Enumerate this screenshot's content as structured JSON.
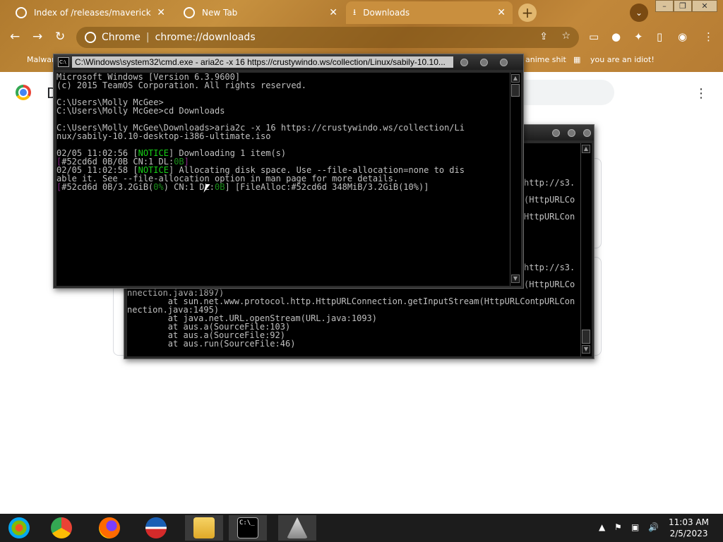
{
  "browser": {
    "tabs": [
      {
        "title": "Index of /releases/maverick"
      },
      {
        "title": "New Tab"
      },
      {
        "title": "Downloads"
      }
    ],
    "omnibox": {
      "site": "Chrome",
      "url": "chrome://downloads"
    },
    "bookmarks": [
      {
        "label": "Malwar"
      },
      {
        "label": "anime shit"
      },
      {
        "label": "you are an idiot!"
      }
    ]
  },
  "page": {
    "title_initial": "D"
  },
  "console_front": {
    "title": "C:\\Windows\\system32\\cmd.exe - aria2c  -x 16 https://crustywindo.ws/collection/Linux/sabily-10.10...",
    "lines": {
      "l1": "Microsoft Windows [Version 6.3.9600]",
      "l2": "(c) 2015 TeamOS Corporation. All rights reserved.",
      "l3": "C:\\Users\\Molly McGee>",
      "l4": "C:\\Users\\Molly McGee>cd Downloads",
      "l5": "C:\\Users\\Molly McGee\\Downloads>aria2c -x 16 https://crustywindo.ws/collection/Li",
      "l6": "nux/sabily-10.10-desktop-i386-ultimate.iso",
      "l7a": "02/05 11:02:56 [",
      "l7b": "NOTICE",
      "l7c": "] Downloading 1 item(s)",
      "l8a": "[",
      "l8b": "#52cd6d 0B/0B CN:1 DL:",
      "l8c": "0B",
      "l8d": "]",
      "l9a": "02/05 11:02:58 [",
      "l9b": "NOTICE",
      "l9c": "] Allocating disk space. Use --file-allocation=none to dis",
      "l10": "able it. See --file-allocation option in man page for more details.",
      "l11a": "[",
      "l11b": "#52cd6d 0B/3.2GiB(",
      "l11c": "0%",
      "l11d": ") CN:1 DL:",
      "l11e": "0B",
      "l11f": "] [FileAlloc:#52cd6d 348MiB/3.2GiB(10%)]"
    }
  },
  "console_back": {
    "right_fragments": [
      "http://s3.",
      "(HttpURLCo",
      "HttpURLCon",
      "http://s3.",
      "(HttpURLCo",
      "HttpURLCon"
    ],
    "lines": {
      "b1": "nnection.java:1897)",
      "b2": "        at sun.net.www.protocol.http.HttpURLConnection.getInputStream(HttpURLCon",
      "b3": "nection.java:1495)",
      "b4": "        at java.net.URL.openStream(URL.java:1093)",
      "b5": "        at aus.a(SourceFile:103)",
      "b6": "        at aus.a(SourceFile:92)",
      "b7": "        at aus.run(SourceFile:46)"
    }
  },
  "taskbar": {
    "time": "11:03 AM",
    "date": "2/5/2023",
    "apps": [
      "start-orb",
      "chrome",
      "firefox",
      "obama-logo",
      "file-explorer",
      "command-prompt",
      "java-app"
    ]
  }
}
